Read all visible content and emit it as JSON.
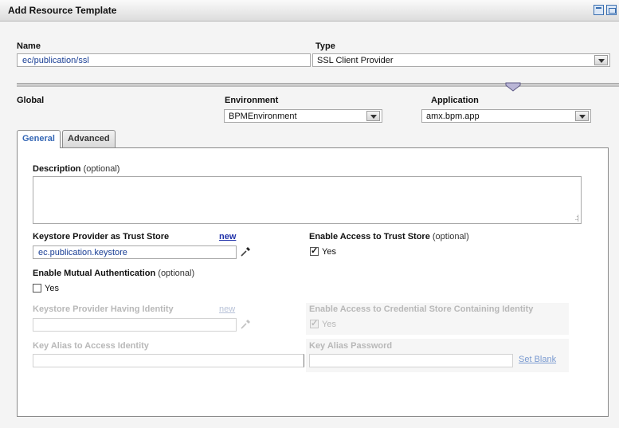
{
  "window": {
    "title": "Add Resource Template"
  },
  "header": {
    "name_label": "Name",
    "name_value": "ec/publication/ssl",
    "type_label": "Type",
    "type_value": "SSL Client Provider"
  },
  "scope": {
    "global_label": "Global",
    "environment_label": "Environment",
    "environment_value": "BPMEnvironment",
    "application_label": "Application",
    "application_value": "amx.bpm.app"
  },
  "tabs": [
    {
      "label": "General",
      "active": true
    },
    {
      "label": "Advanced",
      "active": false
    }
  ],
  "general": {
    "description_label": "Description",
    "description_optional": "(optional)",
    "description_value": "",
    "keystore_trust_label": "Keystore Provider as Trust Store",
    "keystore_trust_new": "new",
    "keystore_trust_value": "ec.publication.keystore",
    "enable_trust_label": "Enable Access to Trust Store",
    "enable_trust_optional": "(optional)",
    "enable_trust_yes": "Yes",
    "enable_trust_checked": true,
    "mutual_auth_label": "Enable Mutual Authentication",
    "mutual_auth_optional": "(optional)",
    "mutual_auth_yes": "Yes",
    "mutual_auth_checked": false,
    "keystore_identity_label": "Keystore Provider Having Identity",
    "keystore_identity_new": "new",
    "credential_store_label": "Enable Access to Credential Store Containing Identity",
    "credential_store_yes": "Yes",
    "credential_store_checked": true,
    "key_alias_label": "Key Alias to Access Identity",
    "key_alias_password_label": "Key Alias Password",
    "set_blank_password": "Set Blank"
  },
  "colors": {
    "link": "#2233aa",
    "active_tab": "#3567b5",
    "field_text": "#1a3f95"
  }
}
